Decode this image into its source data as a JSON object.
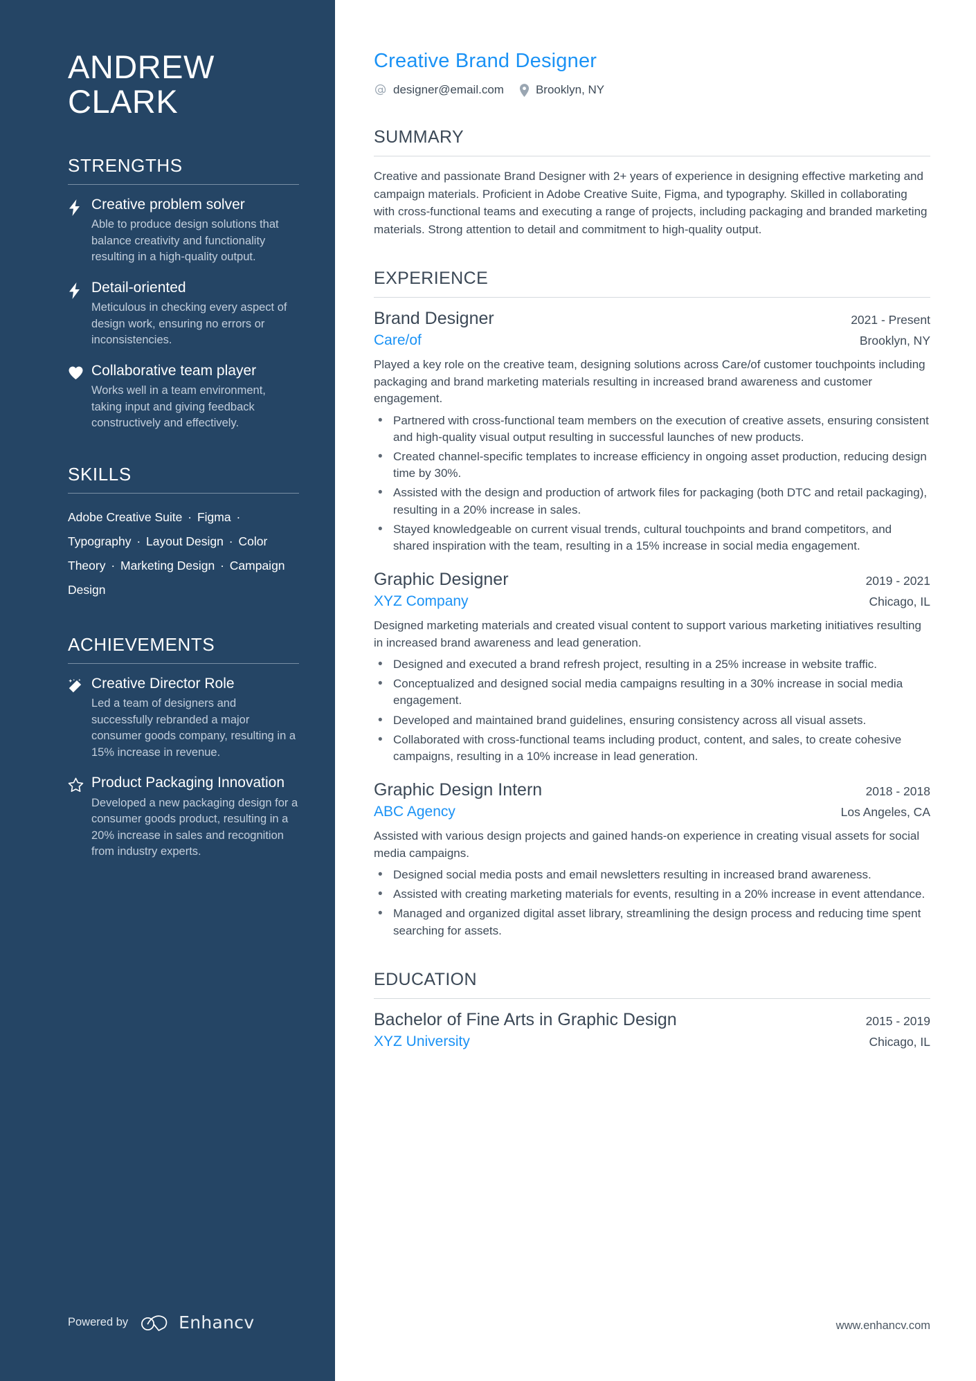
{
  "colors": {
    "sidebar_bg": "#254565",
    "accent": "#1a92f5",
    "heading": "#3b4856",
    "rule": "#d5dade"
  },
  "sidebar": {
    "name_line1": "ANDREW",
    "name_line2": "CLARK",
    "strengths": {
      "heading": "STRENGTHS",
      "items": [
        {
          "icon": "lightning-icon",
          "title": "Creative problem solver",
          "desc": "Able to produce design solutions that balance creativity and functionality resulting in a high-quality output."
        },
        {
          "icon": "lightning-icon",
          "title": "Detail-oriented",
          "desc": "Meticulous in checking every aspect of design work, ensuring no errors or inconsistencies."
        },
        {
          "icon": "heart-icon",
          "title": "Collaborative team player",
          "desc": "Works well in a team environment, taking input and giving feedback constructively and effectively."
        }
      ]
    },
    "skills": {
      "heading": "SKILLS",
      "items": [
        "Adobe Creative Suite",
        "Figma",
        "Typography",
        "Layout Design",
        "Color Theory",
        "Marketing Design",
        "Campaign Design"
      ],
      "separator": "·"
    },
    "achievements": {
      "heading": "ACHIEVEMENTS",
      "items": [
        {
          "icon": "magic-wand-icon",
          "title": "Creative Director Role",
          "desc": "Led a team of designers and successfully rebranded a major consumer goods company, resulting in a 15% increase in revenue."
        },
        {
          "icon": "star-icon",
          "title": "Product Packaging Innovation",
          "desc": "Developed a new packaging design for a consumer goods product, resulting in a 20% increase in sales and recognition from industry experts."
        }
      ]
    },
    "footer": {
      "powered_by": "Powered by",
      "brand": "Enhancv"
    }
  },
  "main": {
    "title": "Creative Brand Designer",
    "contacts": [
      {
        "icon": "at-icon",
        "value": "designer@email.com"
      },
      {
        "icon": "map-pin-icon",
        "value": "Brooklyn, NY"
      }
    ],
    "summary": {
      "heading": "SUMMARY",
      "text": "Creative and passionate Brand Designer with 2+ years of experience in designing effective marketing and campaign materials. Proficient in Adobe Creative Suite, Figma, and typography. Skilled in collaborating with cross-functional teams and executing a range of projects, including packaging and branded marketing materials. Strong attention to detail and commitment to high-quality output."
    },
    "experience": {
      "heading": "EXPERIENCE",
      "entries": [
        {
          "role": "Brand Designer",
          "date": "2021 - Present",
          "org": "Care/of",
          "location": "Brooklyn, NY",
          "desc": "Played a key role on the creative team, designing solutions across Care/of customer touchpoints including packaging and brand marketing materials resulting in increased brand awareness and customer engagement.",
          "bullets": [
            "Partnered with cross-functional team members on the execution of creative assets, ensuring consistent and high-quality visual output resulting in successful launches of new products.",
            "Created channel-specific templates to increase efficiency in ongoing asset production, reducing design time by 30%.",
            "Assisted with the design and production of artwork files for packaging (both DTC and retail packaging), resulting in a 20% increase in sales.",
            "Stayed knowledgeable on current visual trends, cultural touchpoints and brand competitors, and shared inspiration with the team, resulting in a 15% increase in social media engagement."
          ]
        },
        {
          "role": "Graphic Designer",
          "date": "2019 - 2021",
          "org": "XYZ Company",
          "location": "Chicago, IL",
          "desc": "Designed marketing materials and created visual content to support various marketing initiatives resulting in increased brand awareness and lead generation.",
          "bullets": [
            "Designed and executed a brand refresh project, resulting in a 25% increase in website traffic.",
            "Conceptualized and designed social media campaigns resulting in a 30% increase in social media engagement.",
            "Developed and maintained brand guidelines, ensuring consistency across all visual assets.",
            "Collaborated with cross-functional teams including product, content, and sales, to create cohesive campaigns, resulting in a 10% increase in lead generation."
          ]
        },
        {
          "role": "Graphic Design Intern",
          "date": "2018 - 2018",
          "org": "ABC Agency",
          "location": "Los Angeles, CA",
          "desc": "Assisted with various design projects and gained hands-on experience in creating visual assets for social media campaigns.",
          "bullets": [
            "Designed social media posts and email newsletters resulting in increased brand awareness.",
            "Assisted with creating marketing materials for events, resulting in a 20% increase in event attendance.",
            "Managed and organized digital asset library, streamlining the design process and reducing time spent searching for assets."
          ]
        }
      ]
    },
    "education": {
      "heading": "EDUCATION",
      "entries": [
        {
          "role": "Bachelor of Fine Arts in Graphic Design",
          "date": "2015 - 2019",
          "org": "XYZ University",
          "location": "Chicago, IL"
        }
      ]
    },
    "website": "www.enhancv.com"
  }
}
